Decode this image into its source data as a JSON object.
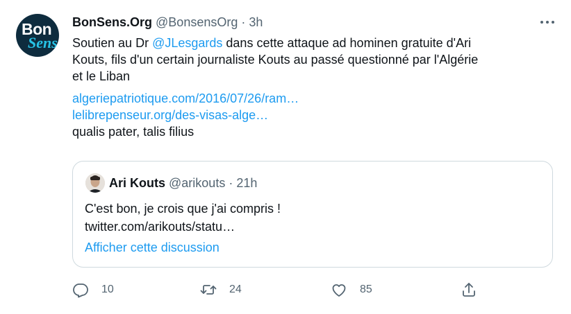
{
  "author": {
    "display_name": "BonSens.Org",
    "handle": "@BonsensOrg",
    "separator": "·",
    "time": "3h",
    "avatar_line1": "Bon",
    "avatar_line2": "Sens"
  },
  "tweet": {
    "line1_prefix": "Soutien au Dr ",
    "mention": "@JLesgards",
    "line1_suffix": " dans cette attaque ad hominen gratuite d'Ari",
    "line2": "Kouts, fils d'un certain journaliste Kouts au passé questionné par l'Algérie",
    "line3": "et le Liban",
    "link1": "algeriepatriotique.com/2016/07/26/ram…",
    "link2": "lelibrepenseur.org/des-visas-alge…",
    "line_last": "qualis pater, talis filius"
  },
  "quoted": {
    "display_name": "Ari Kouts",
    "handle": "@arikouts",
    "separator": "·",
    "time": "21h",
    "text": "C'est bon, je crois que j'ai compris !",
    "link": "twitter.com/arikouts/statu…",
    "show_thread": "Afficher cette discussion"
  },
  "actions": {
    "reply_count": "10",
    "retweet_count": "24",
    "like_count": "85"
  },
  "colors": {
    "link": "#1d9bf0",
    "secondary_text": "#536471",
    "border": "#cfd9de"
  },
  "icons": [
    "more-icon",
    "reply-icon",
    "retweet-icon",
    "like-icon",
    "share-icon"
  ]
}
